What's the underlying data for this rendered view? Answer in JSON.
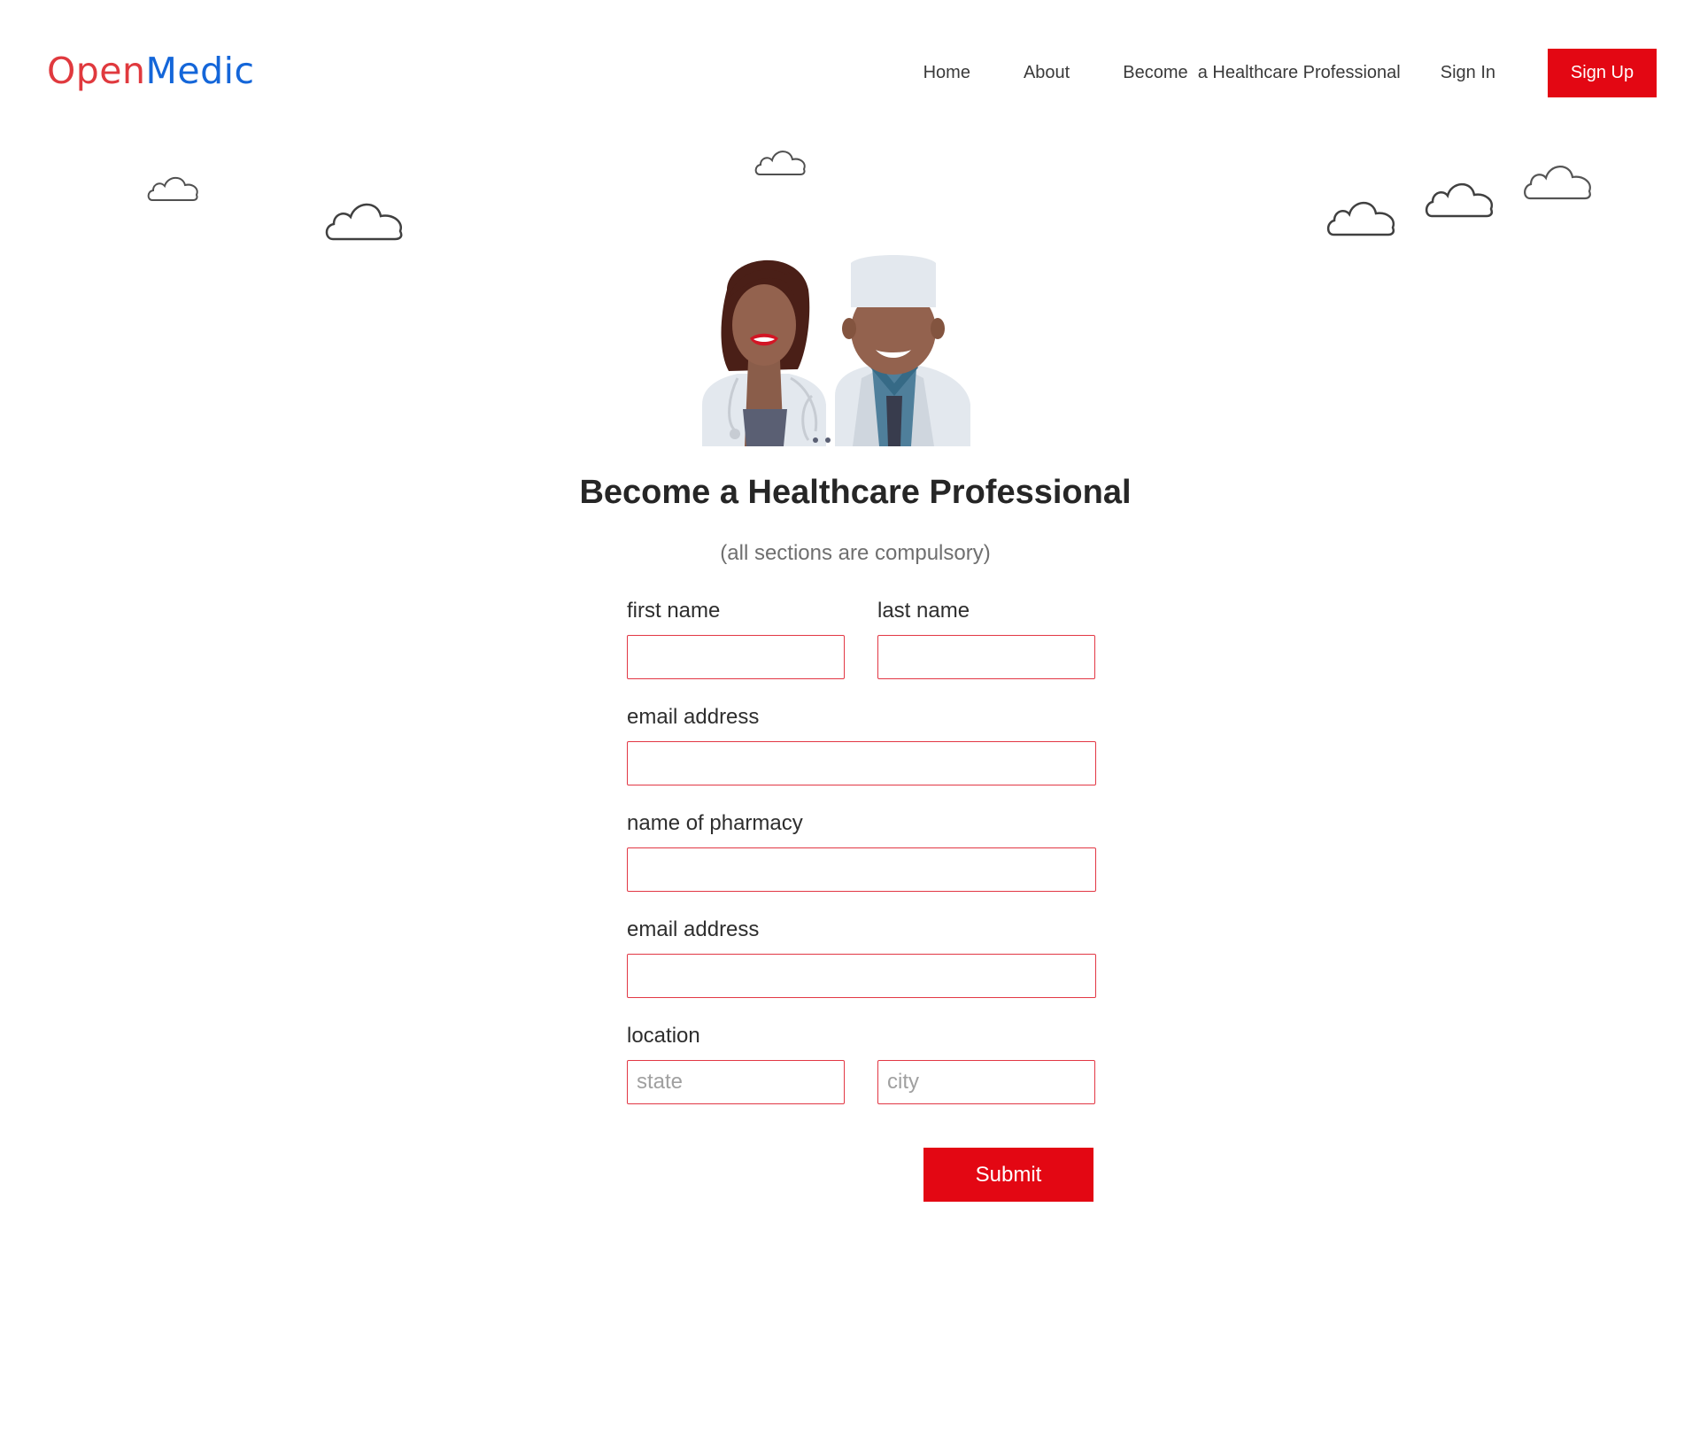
{
  "brand": {
    "part1": "Open",
    "part2": "Medic",
    "color1": "#e0393e",
    "color2": "#1466d9"
  },
  "nav": {
    "home": "Home",
    "about": "About",
    "become": "Become  a Healthcare Professional",
    "signin": "Sign In",
    "signup": "Sign Up"
  },
  "accent": "#e30713",
  "page": {
    "title": "Become a Healthcare Professional",
    "subtitle": "(all sections are compulsory)"
  },
  "form": {
    "first_name_label": "first name",
    "last_name_label": "last name",
    "email_label": "email address",
    "pharmacy_label": "name of pharmacy",
    "email2_label": "email address",
    "location_label": "location",
    "state_placeholder": "state",
    "city_placeholder": "city",
    "submit_label": "Submit"
  },
  "icons": [
    "cloud-icon",
    "doctors-illustration"
  ]
}
